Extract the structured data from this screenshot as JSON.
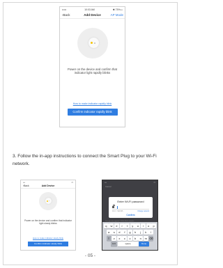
{
  "phone1": {
    "status": {
      "carrier": "••••• ",
      "wifi": "ᯤ",
      "time": "10:03 AM",
      "battery": "✱ 75%▭"
    },
    "nav": {
      "back": "Back",
      "title": "Add Device",
      "right": "AP Mode"
    },
    "message": "Power on the device and confirm that indicator light rapidly blinks",
    "help_link": "How to make indicator rapidly blink",
    "confirm_button": "Confirm indicator rapidly blink"
  },
  "instruction": "3. Follow the in-app instructions to connect the Smart Plug to your Wi-Fi network.",
  "phone2": {
    "status": {
      "carrier": "•••",
      "time": "",
      "battery": "▭"
    },
    "nav": {
      "back": "Back",
      "title": "Add Device"
    },
    "message": "Power on the device and confirm that indicator light slowly blinks",
    "help_link": "How to make indicator slowly blink",
    "confirm_button": "Confirm indicator slowly blink"
  },
  "phone3": {
    "status": {
      "carrier": "•••",
      "battery": "▭"
    },
    "top_label": "Cancel",
    "dialog": {
      "title": "Enter Wi-Fi password",
      "password_value": "",
      "wifi_info": "Wi-Fi : NEUSB...",
      "change_network": "Change network",
      "confirm": "Confirm"
    },
    "note": "This app only supports 2.4GHz Wi-Fi networks",
    "keyboard": {
      "row1": [
        "q",
        "w",
        "e",
        "r",
        "t",
        "y",
        "u",
        "i",
        "o",
        "p"
      ],
      "row2": [
        "a",
        "s",
        "d",
        "f",
        "g",
        "h",
        "j",
        "k",
        "l"
      ],
      "row3": [
        "⇧",
        "z",
        "x",
        "c",
        "v",
        "b",
        "n",
        "m",
        "⌫"
      ],
      "row4": [
        "123",
        "space",
        "Done"
      ]
    }
  },
  "page_number": "- 05 -"
}
